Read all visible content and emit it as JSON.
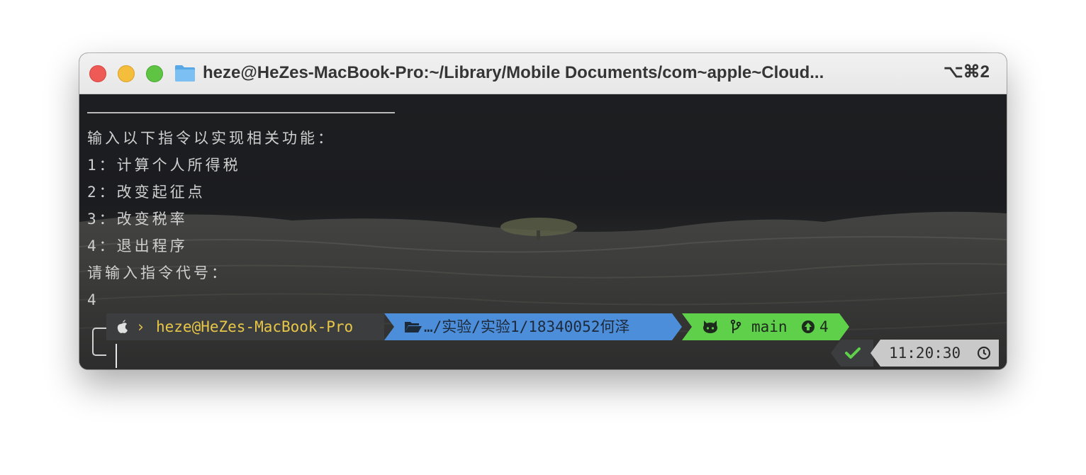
{
  "window": {
    "title": "heze@HeZes-MacBook-Pro:~/Library/Mobile Documents/com~apple~Cloud...",
    "shortcut": "⌥⌘2"
  },
  "terminal": {
    "lines": [
      "输入以下指令以实现相关功能：",
      "1：计算个人所得税",
      "2：改变起征点",
      "3：改变税率",
      "4：退出程序",
      "请输入指令代号：",
      "4"
    ]
  },
  "prompt": {
    "user_host": "heze@HeZes-MacBook-Pro",
    "path": "…/实验/实验1/18340052何泽",
    "branch": "main",
    "ahead_count": "4",
    "time": "11:20:30"
  },
  "colors": {
    "segment_user_bg": "#3b3d3f",
    "segment_user_fg": "#e8c647",
    "segment_path_bg": "#4d8edb",
    "segment_git_bg": "#5fd04a",
    "status_ok": "#5fd04a",
    "time_bg": "#c9c9c9"
  }
}
